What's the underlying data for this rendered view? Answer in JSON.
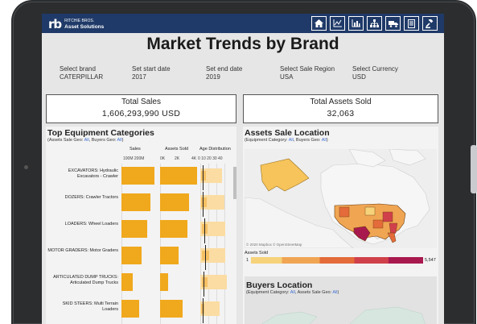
{
  "header": {
    "logo_mark": "rb",
    "logo_line1": "RITCHIE BROS.",
    "logo_line2": "Asset Solutions",
    "nav_icons": [
      "home-icon",
      "line-chart-icon",
      "bar-chart-icon",
      "hierarchy-icon",
      "truck-icon",
      "document-icon",
      "gavel-icon"
    ]
  },
  "title": "Market Trends by Brand",
  "filters": [
    {
      "label": "Select brand",
      "value": "CATERPILLAR"
    },
    {
      "label": "Set start date",
      "value": "2017"
    },
    {
      "label": "Set end date",
      "value": "2019"
    },
    {
      "label": "Select Sale Region",
      "value": "USA"
    },
    {
      "label": "Select Currency",
      "value": "USD"
    }
  ],
  "kpis": {
    "total_sales_label": "Total Sales",
    "total_sales_value": "1,606,293,990 USD",
    "total_assets_label": "Total Assets Sold",
    "total_assets_value": "32,063"
  },
  "categories_panel": {
    "title": "Top Equipment Categories",
    "subtitle_prefix": "(Assets Sale Geo: ",
    "subtitle_geo": "All",
    "subtitle_mid": ", Buyers Geo: ",
    "subtitle_buyers": "All",
    "subtitle_suffix": ")",
    "col_sales": "Sales",
    "col_assets": "Assets Sold",
    "col_dist": "Age Distribution",
    "sales_ticks": "100M 200M",
    "assets_ticks": [
      "0K",
      "2K",
      "4K"
    ],
    "dist_ticks": "0  10  20  30  40"
  },
  "chart_data": {
    "type": "bar",
    "categories": [
      "EXCAVATORS: Hydraulic Excavators - Crawler",
      "DOZERS: Crawler Tractors",
      "LOADERS: Wheel Loaders",
      "MOTOR GRADERS: Motor Graders",
      "ARTICULATED DUMP TRUCKS: Articulated Dump Trucks",
      "SKID STEERS: Multi Terrain Loaders"
    ],
    "series": [
      {
        "name": "Sales",
        "values": [
          290,
          255,
          230,
          180,
          100,
          160
        ]
      },
      {
        "name": "Assets Sold",
        "values": [
          4800,
          3800,
          3500,
          2400,
          1000,
          2900
        ]
      }
    ],
    "age_median": [
      3,
      3,
      5,
      6,
      4,
      3
    ],
    "age_q1": [
      1,
      1,
      2,
      2,
      2,
      1
    ],
    "age_q3": [
      7,
      8,
      9,
      11,
      9,
      5
    ],
    "age_max": [
      27,
      30,
      31,
      31,
      33,
      24
    ],
    "sales_xlim": [
      0,
      300
    ],
    "assets_xlim": [
      0,
      5000
    ],
    "age_xlim": [
      0,
      40
    ]
  },
  "map_panel": {
    "title": "Assets Sale Location",
    "subtitle_prefix": "(Equipment Category: ",
    "subtitle_cat": "All",
    "subtitle_mid": ", Buyers Geo: ",
    "subtitle_buyers": "All",
    "subtitle_suffix": ")",
    "attribution": "© 2020 Mapbox © OpenStreetMap",
    "legend_title": "Assets Sold",
    "legend_min": "1",
    "legend_max": "5,547"
  },
  "buyers_panel": {
    "title": "Buyers Location",
    "subtitle_prefix": "(Equipment Category: ",
    "subtitle_cat": "All",
    "subtitle_mid": ", Assets Sale Geo: ",
    "subtitle_geo": "All",
    "subtitle_suffix": ")"
  }
}
